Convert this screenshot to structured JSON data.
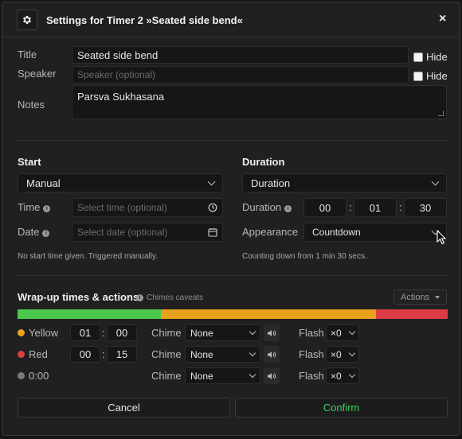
{
  "dialog": {
    "title": "Settings for Timer 2 »Seated side bend«",
    "close_label": "×"
  },
  "form": {
    "title_label": "Title",
    "title_value": "Seated side bend",
    "speaker_label": "Speaker",
    "speaker_placeholder": "Speaker (optional)",
    "hide_label": "Hide",
    "notes_label": "Notes",
    "notes_value": "Parsva Sukhasana"
  },
  "start": {
    "heading": "Start",
    "mode": "Manual",
    "time_label": "Time",
    "time_placeholder": "Select time (optional)",
    "date_label": "Date",
    "date_placeholder": "Select date (optional)",
    "hint": "No start time given. Triggered manually."
  },
  "duration": {
    "heading": "Duration",
    "mode": "Duration",
    "duration_label": "Duration",
    "hours": "00",
    "minutes": "01",
    "seconds": "30",
    "sep": ":",
    "appearance_label": "Appearance",
    "appearance_value": "Countdown",
    "hint": "Counting down from 1 min 30 secs."
  },
  "wrapup": {
    "heading": "Wrap-up times & actions",
    "chimes_caveats": "Chimes caveats",
    "actions_label": "Actions",
    "bar": [
      {
        "color": "#4bc94f",
        "fraction": 0.3333
      },
      {
        "color": "#e8a11d",
        "fraction": 0.5
      },
      {
        "color": "#dd3c44",
        "fraction": 0.1667
      }
    ],
    "rows": [
      {
        "label": "Yellow",
        "color": "#e8a11d",
        "mm": "01",
        "ss": "00",
        "chime_label": "Chime",
        "chime": "None",
        "flash_label": "Flash",
        "flash": "×0"
      },
      {
        "label": "Red",
        "color": "#dd3c44",
        "mm": "00",
        "ss": "15",
        "chime_label": "Chime",
        "chime": "None",
        "flash_label": "Flash",
        "flash": "×0"
      },
      {
        "label": "0:00",
        "color": "#7a7a7a",
        "mm": "",
        "ss": "",
        "chime_label": "Chime",
        "chime": "None",
        "flash_label": "Flash",
        "flash": "×0"
      }
    ]
  },
  "footer": {
    "cancel": "Cancel",
    "confirm": "Confirm",
    "confirm_color": "#3ccf5c"
  }
}
